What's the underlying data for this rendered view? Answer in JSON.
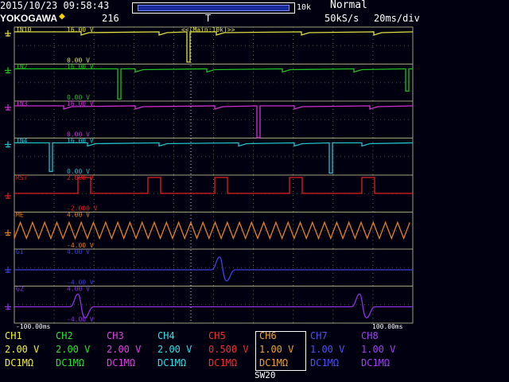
{
  "header": {
    "datetime": "2015/10/23 09:58:43",
    "brand": "YOKOGAWA",
    "count": "216",
    "zoom_label": "10k",
    "trigger_mode": "Normal",
    "sample_rate": "50kS/s",
    "time_div": "20ms/div",
    "trigger_marker": "T"
  },
  "screen": {
    "zoom_window_label": "<<(Main:10k)>>",
    "time_left": "-100.00ms",
    "time_right": "100.00ms",
    "traces": [
      {
        "name": "IN10",
        "top": "16.00 V",
        "bottom": "0.00 V",
        "color": "#e0e040"
      },
      {
        "name": "IN2",
        "top": "16.00 V",
        "bottom": "0.00 V",
        "color": "#20c020"
      },
      {
        "name": "IN3",
        "top": "16.00 V",
        "bottom": "0.00 V",
        "color": "#d030d0"
      },
      {
        "name": "IN4",
        "top": "16.00 V",
        "bottom": "0.00 V",
        "color": "#20c0c8"
      },
      {
        "name": "RST",
        "top": "2.000 V",
        "bottom": "-2.000 V",
        "color": "#e02020"
      },
      {
        "name": "ME",
        "top": "4.00 V",
        "bottom": "-4.00 V",
        "color": "#e08020"
      },
      {
        "name": "G1",
        "top": "4.00 V",
        "bottom": "-4.00 V",
        "color": "#4040e0"
      },
      {
        "name": "G2",
        "top": "4.00 V",
        "bottom": "-4.00 V",
        "color": "#9030e0"
      }
    ]
  },
  "channels": [
    {
      "name": "CH1",
      "volts": "2.00 V",
      "coupling": "DC1MΩ",
      "color": "#f0f040"
    },
    {
      "name": "CH2",
      "volts": "2.00 V",
      "coupling": "DC1MΩ",
      "color": "#30e030"
    },
    {
      "name": "CH3",
      "volts": "2.00 V",
      "coupling": "DC1MΩ",
      "color": "#e040e0"
    },
    {
      "name": "CH4",
      "volts": "2.00 V",
      "coupling": "DC1MΩ",
      "color": "#30e0e8"
    },
    {
      "name": "CH5",
      "volts": "0.500 V",
      "coupling": "DC1MΩ",
      "color": "#f03030"
    },
    {
      "name": "CH6",
      "volts": "1.00 V",
      "coupling": "DC1MΩ",
      "color": "#f0a030"
    },
    {
      "name": "CH7",
      "volts": "1.00 V",
      "coupling": "DC1MΩ",
      "color": "#5050f0"
    },
    {
      "name": "CH8",
      "volts": "1.00 V",
      "coupling": "DC1MΩ",
      "color": "#a040f0"
    }
  ],
  "footer": {
    "switch": "SW20"
  }
}
